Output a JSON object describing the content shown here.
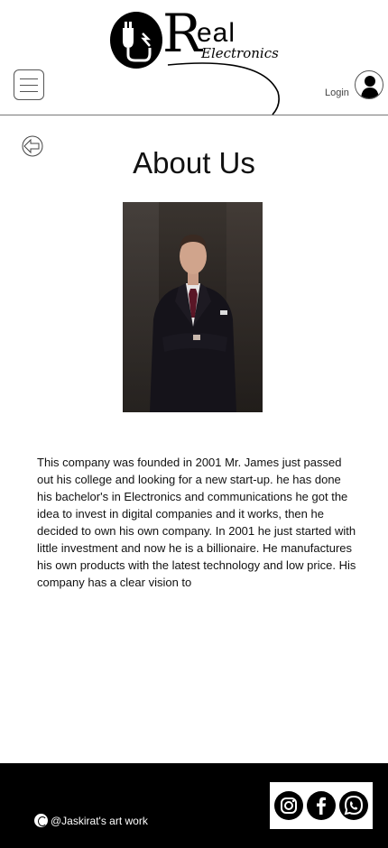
{
  "header": {
    "logo": {
      "big_letter": "R",
      "word": "eal",
      "subtitle": "Electronics"
    },
    "login_label": "Login",
    "menu_icon": "hamburger-menu-icon",
    "avatar_icon": "user-avatar-icon"
  },
  "main": {
    "back_icon": "back-arrow-icon",
    "title": "About Us",
    "photo": "portrait of man in dark suit",
    "about_text": "This company was founded in 2001 Mr. James just passed out his college and looking for a new start-up. he has done his bachelor's in Electronics and communications he got the idea to invest in digital companies and it works, then he decided to own his own company. In 2001 he just started with little investment and now he is a billionaire. He manufactures his own products with the latest technology and low price. His company has a clear vision to"
  },
  "footer": {
    "copyright_text": "@Jaskirat's art work",
    "social": [
      "instagram-icon",
      "facebook-icon",
      "whatsapp-icon"
    ]
  }
}
